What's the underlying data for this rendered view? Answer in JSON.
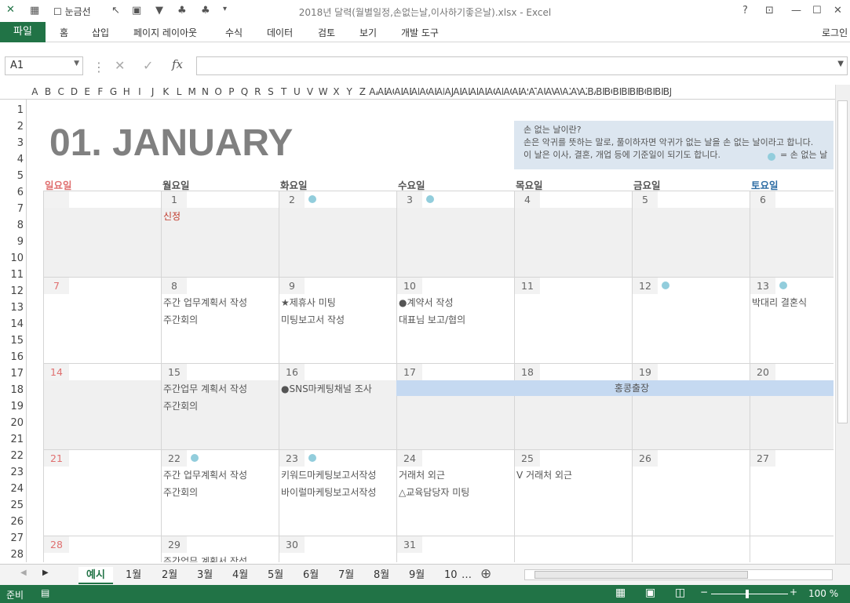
{
  "window": {
    "title": "2018년 달력(월별일정,손없는날,이사하기좋은날).xlsx - Excel",
    "gridlines_label": "눈금선",
    "login": "로그인"
  },
  "ribbon": {
    "file": "파일",
    "tabs": [
      "홈",
      "삽입",
      "페이지 레이아웃",
      "수식",
      "데이터",
      "검토",
      "보기",
      "개발 도구"
    ]
  },
  "namebox": "A1",
  "columns": [
    "A",
    "B",
    "C",
    "D",
    "E",
    "F",
    "G",
    "H",
    "I",
    "J",
    "K",
    "L",
    "M",
    "N",
    "O",
    "P",
    "Q",
    "R",
    "S",
    "T",
    "U",
    "V",
    "W",
    "X",
    "Y",
    "Z",
    "AA",
    "AB",
    "AC",
    "AD",
    "AE",
    "AF",
    "AG",
    "AH",
    "AI",
    "AJ",
    "AK",
    "AL",
    "AM",
    "AN",
    "AC",
    "AP",
    "AQ",
    "AR",
    "AS",
    "AT",
    "AU",
    "AV",
    "AW",
    "AX",
    "AY",
    "AZ",
    "BA",
    "BB",
    "BC",
    "BD",
    "BE",
    "BF",
    "BG",
    "BH",
    "BI",
    "BJ"
  ],
  "rows": [
    "1",
    "2",
    "3",
    "4",
    "5",
    "6",
    "7",
    "8",
    "9",
    "10",
    "11",
    "12",
    "13",
    "14",
    "15",
    "16",
    "17",
    "18",
    "19",
    "20",
    "21",
    "22",
    "23",
    "24",
    "25",
    "26",
    "27",
    "28"
  ],
  "calendar": {
    "title": "01. JANUARY",
    "info": [
      "손 없는 날이란?",
      "손은 악귀를 뜻하는 말로, 풀이하자면 악귀가 없는 날을 손 없는 날이라고 합니다.",
      "이 날은 이사, 결혼, 개업 등에 기준일이 되기도 합니다."
    ],
    "legend": "= 손 없는 날",
    "days": [
      "일요일",
      "월요일",
      "화요일",
      "수요일",
      "목요일",
      "금요일",
      "토요일"
    ],
    "weeks": [
      {
        "dates": [
          "",
          "1",
          "2",
          "3",
          "4",
          "5",
          "6"
        ],
        "events": [
          [],
          [
            "신정"
          ],
          [],
          [],
          [],
          [],
          []
        ]
      },
      {
        "dates": [
          "7",
          "8",
          "9",
          "10",
          "11",
          "12",
          "13"
        ],
        "events": [
          [],
          [
            "주간 업무계획서 작성",
            "주간회의"
          ],
          [
            "★제휴사 미팅",
            "미팅보고서 작성"
          ],
          [
            "●계약서 작성",
            "대표님 보고/협의"
          ],
          [],
          [],
          [
            "박대리 결혼식"
          ]
        ]
      },
      {
        "dates": [
          "14",
          "15",
          "16",
          "17",
          "18",
          "19",
          "20"
        ],
        "events": [
          [],
          [
            "주간업무 계획서 작성",
            "주간회의"
          ],
          [
            "●SNS마케팅채널 조사"
          ],
          [],
          [],
          [],
          []
        ],
        "banner": "홍콩출장"
      },
      {
        "dates": [
          "21",
          "22",
          "23",
          "24",
          "25",
          "26",
          "27"
        ],
        "events": [
          [],
          [
            "주간 업무계획서 작성",
            "주간회의"
          ],
          [
            "키워드마케팅보고서작성",
            "바이럴마케팅보고서작성"
          ],
          [
            "거래처 외근",
            "△교육담당자 미팅"
          ],
          [
            "V 거래처 외근"
          ],
          [],
          []
        ]
      },
      {
        "dates": [
          "28",
          "29",
          "30",
          "31",
          "",
          "",
          ""
        ],
        "events": [
          [],
          [
            "주간업무 계획서 작성"
          ],
          [],
          [],
          [],
          [],
          []
        ]
      }
    ]
  },
  "sheets": [
    "예시",
    "1월",
    "2월",
    "3월",
    "4월",
    "5월",
    "6월",
    "7월",
    "8월",
    "9월",
    "10"
  ],
  "status": {
    "ready": "준비",
    "zoom": "100 %"
  }
}
